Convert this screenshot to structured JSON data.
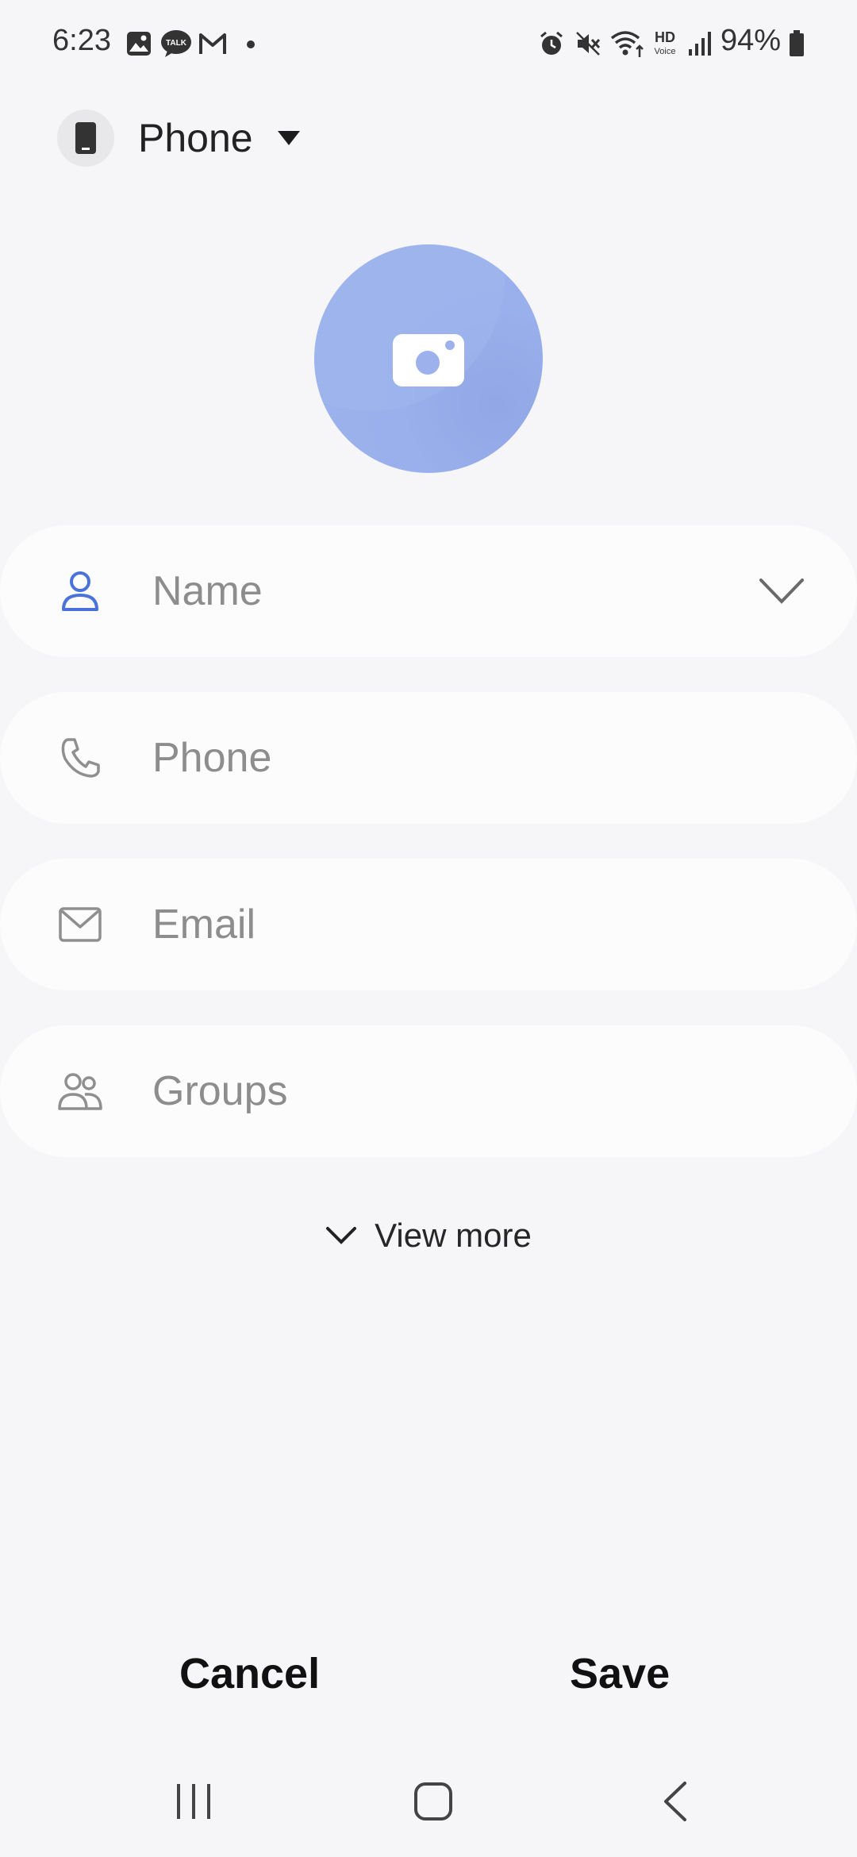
{
  "status_bar": {
    "time": "6:23",
    "battery": "94%",
    "notification_icons": [
      "gallery-icon",
      "talk-icon",
      "gmail-icon",
      "dot-icon"
    ],
    "system_icons": [
      "alarm-icon",
      "mute-icon",
      "wifi-icon",
      "hd-voice-icon",
      "signal-icon",
      "battery-icon"
    ],
    "hd_text": "HD",
    "voice_text": "Voice",
    "talk_text": "TALK"
  },
  "storage": {
    "label": "Phone"
  },
  "fields": {
    "name": {
      "placeholder": "Name"
    },
    "phone": {
      "placeholder": "Phone"
    },
    "email": {
      "placeholder": "Email"
    },
    "groups": {
      "placeholder": "Groups"
    }
  },
  "view_more": {
    "label": "View more"
  },
  "actions": {
    "cancel": "Cancel",
    "save": "Save"
  },
  "colors": {
    "accent": "#4a73d9",
    "avatar": "#9bb0ea",
    "background": "#f6f6f8"
  }
}
